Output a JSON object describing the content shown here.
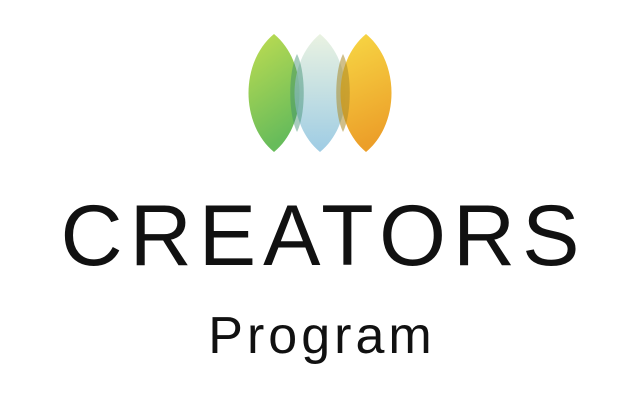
{
  "logo": {
    "title": "CREATORS",
    "subtitle": "Program",
    "mark_icon": "three-overlapping-leaves-icon",
    "colors": {
      "leaf_left_top": "#b9d94a",
      "leaf_left_bottom": "#6cbf4f",
      "leaf_middle_top": "#d9ead9",
      "leaf_middle_bottom": "#8fc4dc",
      "leaf_right_top": "#f6d23a",
      "leaf_right_bottom": "#eea21e",
      "text": "#111111"
    }
  }
}
